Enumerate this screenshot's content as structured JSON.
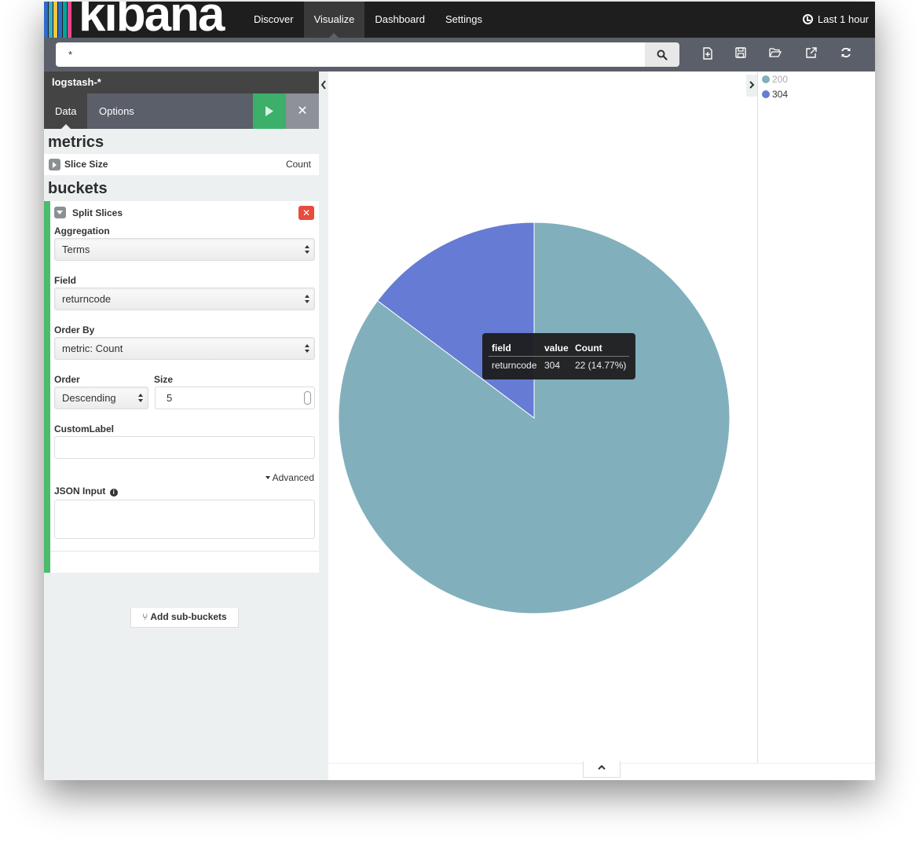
{
  "app": {
    "logo_text": "kibana"
  },
  "nav": {
    "items": [
      {
        "label": "Discover"
      },
      {
        "label": "Visualize"
      },
      {
        "label": "Dashboard"
      },
      {
        "label": "Settings"
      }
    ],
    "active": "Visualize",
    "time_label": "Last 1 hour"
  },
  "search": {
    "value": "*"
  },
  "toolbar": {
    "icons": [
      "new-visualization-icon",
      "save-icon",
      "open-icon",
      "share-icon",
      "refresh-icon"
    ]
  },
  "sidebar": {
    "index_pattern": "logstash-*",
    "tabs": [
      {
        "label": "Data"
      },
      {
        "label": "Options"
      }
    ],
    "metrics_title": "metrics",
    "metric": {
      "label": "Slice Size",
      "value": "Count"
    },
    "buckets_title": "buckets",
    "bucket": {
      "title": "Split Slices",
      "aggregation_label": "Aggregation",
      "aggregation_value": "Terms",
      "field_label": "Field",
      "field_value": "returncode",
      "order_by_label": "Order By",
      "order_by_value": "metric: Count",
      "order_label": "Order",
      "order_value": "Descending",
      "size_label": "Size",
      "size_value": "5",
      "custom_label_label": "CustomLabel",
      "custom_label_value": "",
      "advanced_label": "Advanced",
      "json_input_label": "JSON Input"
    },
    "add_sub_buckets": "Add sub-buckets"
  },
  "legend": [
    {
      "label": "200",
      "color": "#81b0bc"
    },
    {
      "label": "304",
      "color": "#667bd3"
    }
  ],
  "tooltip": {
    "headers": [
      "field",
      "value",
      "Count"
    ],
    "row": [
      "returncode",
      "304",
      "22 (14.77%)"
    ]
  },
  "chart_data": {
    "type": "pie",
    "slices": [
      {
        "label": "200",
        "value": 85.23,
        "color": "#81b0bc"
      },
      {
        "label": "304",
        "value": 14.77,
        "color": "#667bd3"
      }
    ]
  },
  "colors": {
    "nav_bg": "#1e1e1e",
    "search_bar_bg": "#5b5f69",
    "apply_green": "#3caf6b",
    "bucket_accent": "#4bbc6c",
    "remove_red": "#e74c3c",
    "logo_stripes": [
      "#3ab1c8",
      "#e8488b",
      "#f3c63b",
      "#2e6bc6",
      "#00a69b"
    ]
  }
}
